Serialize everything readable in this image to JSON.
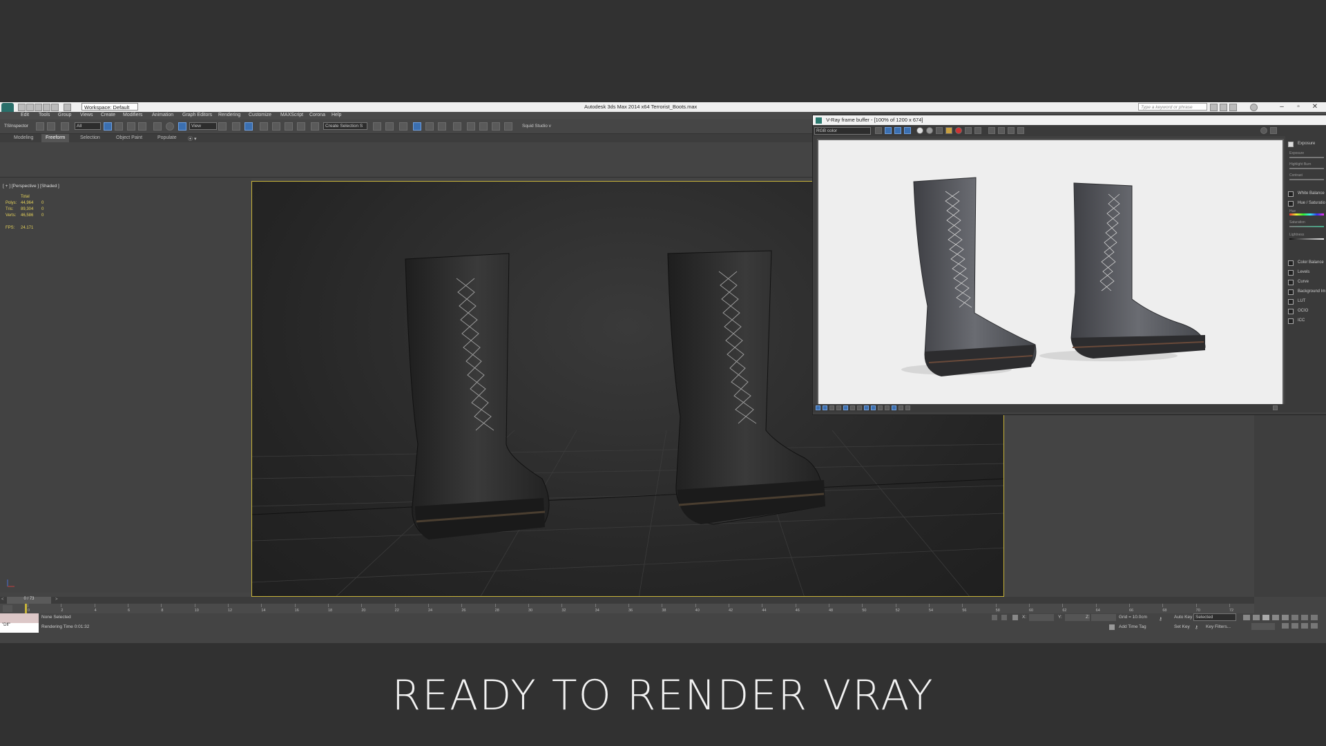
{
  "app": {
    "title": "Autodesk 3ds Max  2014 x64    Terrorist_Boots.max",
    "workspace": "Workspace: Default",
    "search_placeholder": "Type a keyword or phrase"
  },
  "menu": [
    "Edit",
    "Tools",
    "Group",
    "Views",
    "Create",
    "Modifiers",
    "Animation",
    "Graph Editors",
    "Rendering",
    "Customize",
    "MAXScript",
    "Corona",
    "Help"
  ],
  "toolbar": {
    "left_label": "TSInspector",
    "filter_value": "All",
    "ref_coord": "View",
    "selection_set": "Create Selection S",
    "plugin_label": "Squid Studio v"
  },
  "ribbon_tabs": [
    "Modeling",
    "Freeform",
    "Selection",
    "Object Paint",
    "Populate"
  ],
  "ribbon_active": "Freeform",
  "viewport": {
    "label": "[ + ] [Perspective ] [Shaded ]",
    "stats_header": "Total",
    "stats": [
      {
        "label": "Polys:",
        "value": "44,964",
        "sel": "0"
      },
      {
        "label": "Tris:",
        "value": "89,304",
        "sel": "0"
      },
      {
        "label": "Verts:",
        "value": "46,586",
        "sel": "0"
      }
    ],
    "fps_label": "FPS:",
    "fps_value": "24.171"
  },
  "vfb": {
    "title": "V-Ray frame buffer - [100% of 1200 x 674]",
    "channel": "RGB color",
    "side_items": [
      {
        "label": "Exposure",
        "checked": true
      },
      {
        "label": "White Balance",
        "checked": false
      },
      {
        "label": "Hue / Saturatio",
        "checked": false
      },
      {
        "label": "Color Balance",
        "checked": false
      },
      {
        "label": "Levels",
        "checked": false
      },
      {
        "label": "Curve",
        "checked": false
      },
      {
        "label": "Background Im",
        "checked": false
      },
      {
        "label": "LUT",
        "checked": false
      },
      {
        "label": "OCIO",
        "checked": false
      },
      {
        "label": "ICC",
        "checked": false
      }
    ],
    "sliders": [
      "Exposure",
      "Highlight Burn",
      "Contrast",
      "Hue",
      "Saturation",
      "Lightness"
    ]
  },
  "timeline": {
    "frame_counter": "0 / 73",
    "ticks": [
      "0",
      "2",
      "4",
      "6",
      "8",
      "10",
      "12",
      "14",
      "16",
      "18",
      "20",
      "22",
      "24",
      "26",
      "28",
      "30",
      "32",
      "34",
      "36",
      "38",
      "40",
      "42",
      "44",
      "46",
      "48",
      "50",
      "52",
      "54",
      "56",
      "58",
      "60",
      "62",
      "64",
      "66",
      "68",
      "70",
      "72"
    ]
  },
  "status": {
    "selection": "None Selected",
    "render_time": "Rendering Time  0:01:32",
    "grid": "Grid = 10.0cm",
    "add_time_tag": "Add Time Tag",
    "auto_key": "Auto Key",
    "set_key": "Set Key",
    "selected_dd": "Selected",
    "key_filters": "Key Filters...",
    "x_label": "X:",
    "y_label": "Y:",
    "z_label": "Z:",
    "script_value": "\"Dff\""
  },
  "caption": "READY TO RENDER VRAY"
}
